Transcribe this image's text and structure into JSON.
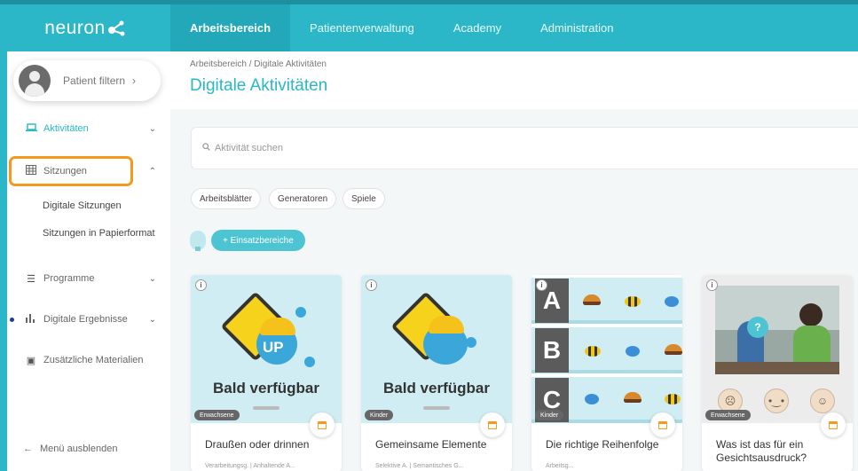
{
  "brand": {
    "logo_text": "neuron"
  },
  "top_nav": [
    {
      "label": "Arbeitsbereich",
      "active": true
    },
    {
      "label": "Patientenverwaltung",
      "active": false
    },
    {
      "label": "Academy",
      "active": false
    },
    {
      "label": "Administration",
      "active": false
    }
  ],
  "sidebar": {
    "patient_filter": "Patient filtern",
    "items": [
      {
        "label": "Aktivitäten",
        "icon": "laptop-icon"
      },
      {
        "label": "Sitzungen",
        "icon": "grid-icon"
      },
      {
        "label": "Programme",
        "icon": "list-icon"
      },
      {
        "label": "Digitale Ergebnisse",
        "icon": "bar-chart-icon"
      },
      {
        "label": "Zusätzliche Materialien",
        "icon": "box-icon"
      }
    ],
    "sub_items": [
      "Digitale Sitzungen",
      "Sitzungen in Papierformat"
    ],
    "collapse": "Menü ausblenden"
  },
  "header": {
    "breadcrumb": "Arbeitsbereich / Digitale Aktivitäten",
    "title": "Digitale Aktivitäten"
  },
  "search": {
    "placeholder": "Aktivität suchen"
  },
  "filters": [
    "Arbeitsblätter",
    "Generatoren",
    "Spiele"
  ],
  "einsatz_button": "+ Einsatzbereiche",
  "cards": [
    {
      "overlay": "Bald verfügbar",
      "tag": "Erwachsene",
      "title": "Draußen oder drinnen",
      "subtitle": "Verarbeitungsg. | Anhaltende A..."
    },
    {
      "overlay": "Bald verfügbar",
      "tag": "Kinder",
      "title": "Gemeinsame Elemente",
      "subtitle": "Selektive A. | Semantisches G..."
    },
    {
      "letters": [
        "A",
        "B",
        "C"
      ],
      "tag": "Kinder",
      "title": "Die richtige Reihenfolge",
      "subtitle": "Arbeitsg..."
    },
    {
      "tag": "Erwachsene",
      "title": "Was ist das für ein Gesichtsausdruck?",
      "subtitle": "",
      "bubble": "?"
    }
  ],
  "colors": {
    "brand": "#2bb7c7",
    "highlight": "#f39a1e"
  }
}
